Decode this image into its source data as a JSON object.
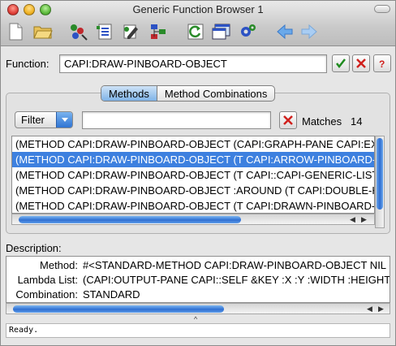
{
  "window": {
    "title": "Generic Function Browser 1"
  },
  "toolbar": {
    "icons": [
      "new-document-icon",
      "open-folder-icon",
      "browse-inspect-icon",
      "class-list-icon",
      "edit-icon",
      "tree-icon",
      "refresh-icon",
      "window-icon",
      "settings-gear-icon",
      "back-arrow-icon",
      "forward-arrow-icon"
    ],
    "accent": "#3d80df"
  },
  "function": {
    "label": "Function:",
    "value": "CAPI:DRAW-PINBOARD-OBJECT"
  },
  "tabs": [
    {
      "label": "Methods",
      "active": true
    },
    {
      "label": "Method Combinations",
      "active": false
    }
  ],
  "filter": {
    "button_label": "Filter",
    "value": "",
    "matches_label": "Matches",
    "matches_count": "14"
  },
  "methods": [
    "(METHOD CAPI:DRAW-PINBOARD-OBJECT (CAPI:GRAPH-PANE CAPI:EX",
    "(METHOD CAPI:DRAW-PINBOARD-OBJECT (T CAPI:ARROW-PINBOARD-",
    "(METHOD CAPI:DRAW-PINBOARD-OBJECT (T CAPI::CAPI-GENERIC-LIST",
    "(METHOD CAPI:DRAW-PINBOARD-OBJECT :AROUND (T CAPI:DOUBLE-H",
    "(METHOD CAPI:DRAW-PINBOARD-OBJECT (T CAPI:DRAWN-PINBOARD-"
  ],
  "selected_index": 1,
  "description": {
    "label": "Description:",
    "rows": [
      {
        "key": "Method:",
        "value": "#<STANDARD-METHOD CAPI:DRAW-PINBOARD-OBJECT NIL ("
      },
      {
        "key": "Lambda List:",
        "value": "(CAPI:OUTPUT-PANE CAPI::SELF &KEY :X :Y :WIDTH :HEIGHT &"
      },
      {
        "key": "Combination:",
        "value": "STANDARD"
      }
    ]
  },
  "status": {
    "text": "Ready."
  }
}
